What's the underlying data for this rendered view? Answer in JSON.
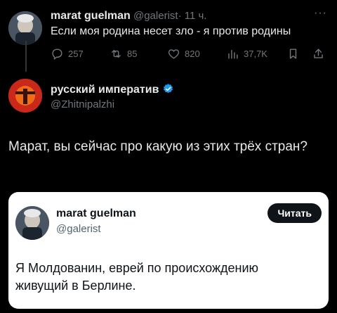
{
  "first_post": {
    "author_name": "marat guelman",
    "author_handle": "@galerist",
    "separator": "·",
    "time": "11 ч.",
    "text": "Если моя родина несет зло - я против родины",
    "stats": {
      "replies": "257",
      "reposts": "85",
      "likes": "820",
      "views": "37,7K"
    },
    "more": "···"
  },
  "reply": {
    "author_name": "русский императив",
    "author_handle": "@Zhitnipalzhi",
    "text": "Марат, вы сейчас про какую из этих трёх стран?"
  },
  "embedded": {
    "author_name": "marat guelman",
    "author_handle": "@galerist",
    "read_button": "Читать",
    "text": "Я Молдованин, еврей по происхождению живущий в Берлине."
  },
  "colors": {
    "background": "#000000",
    "text": "#e7e9ea",
    "muted": "#71767b",
    "verified": "#1d9bf0"
  }
}
